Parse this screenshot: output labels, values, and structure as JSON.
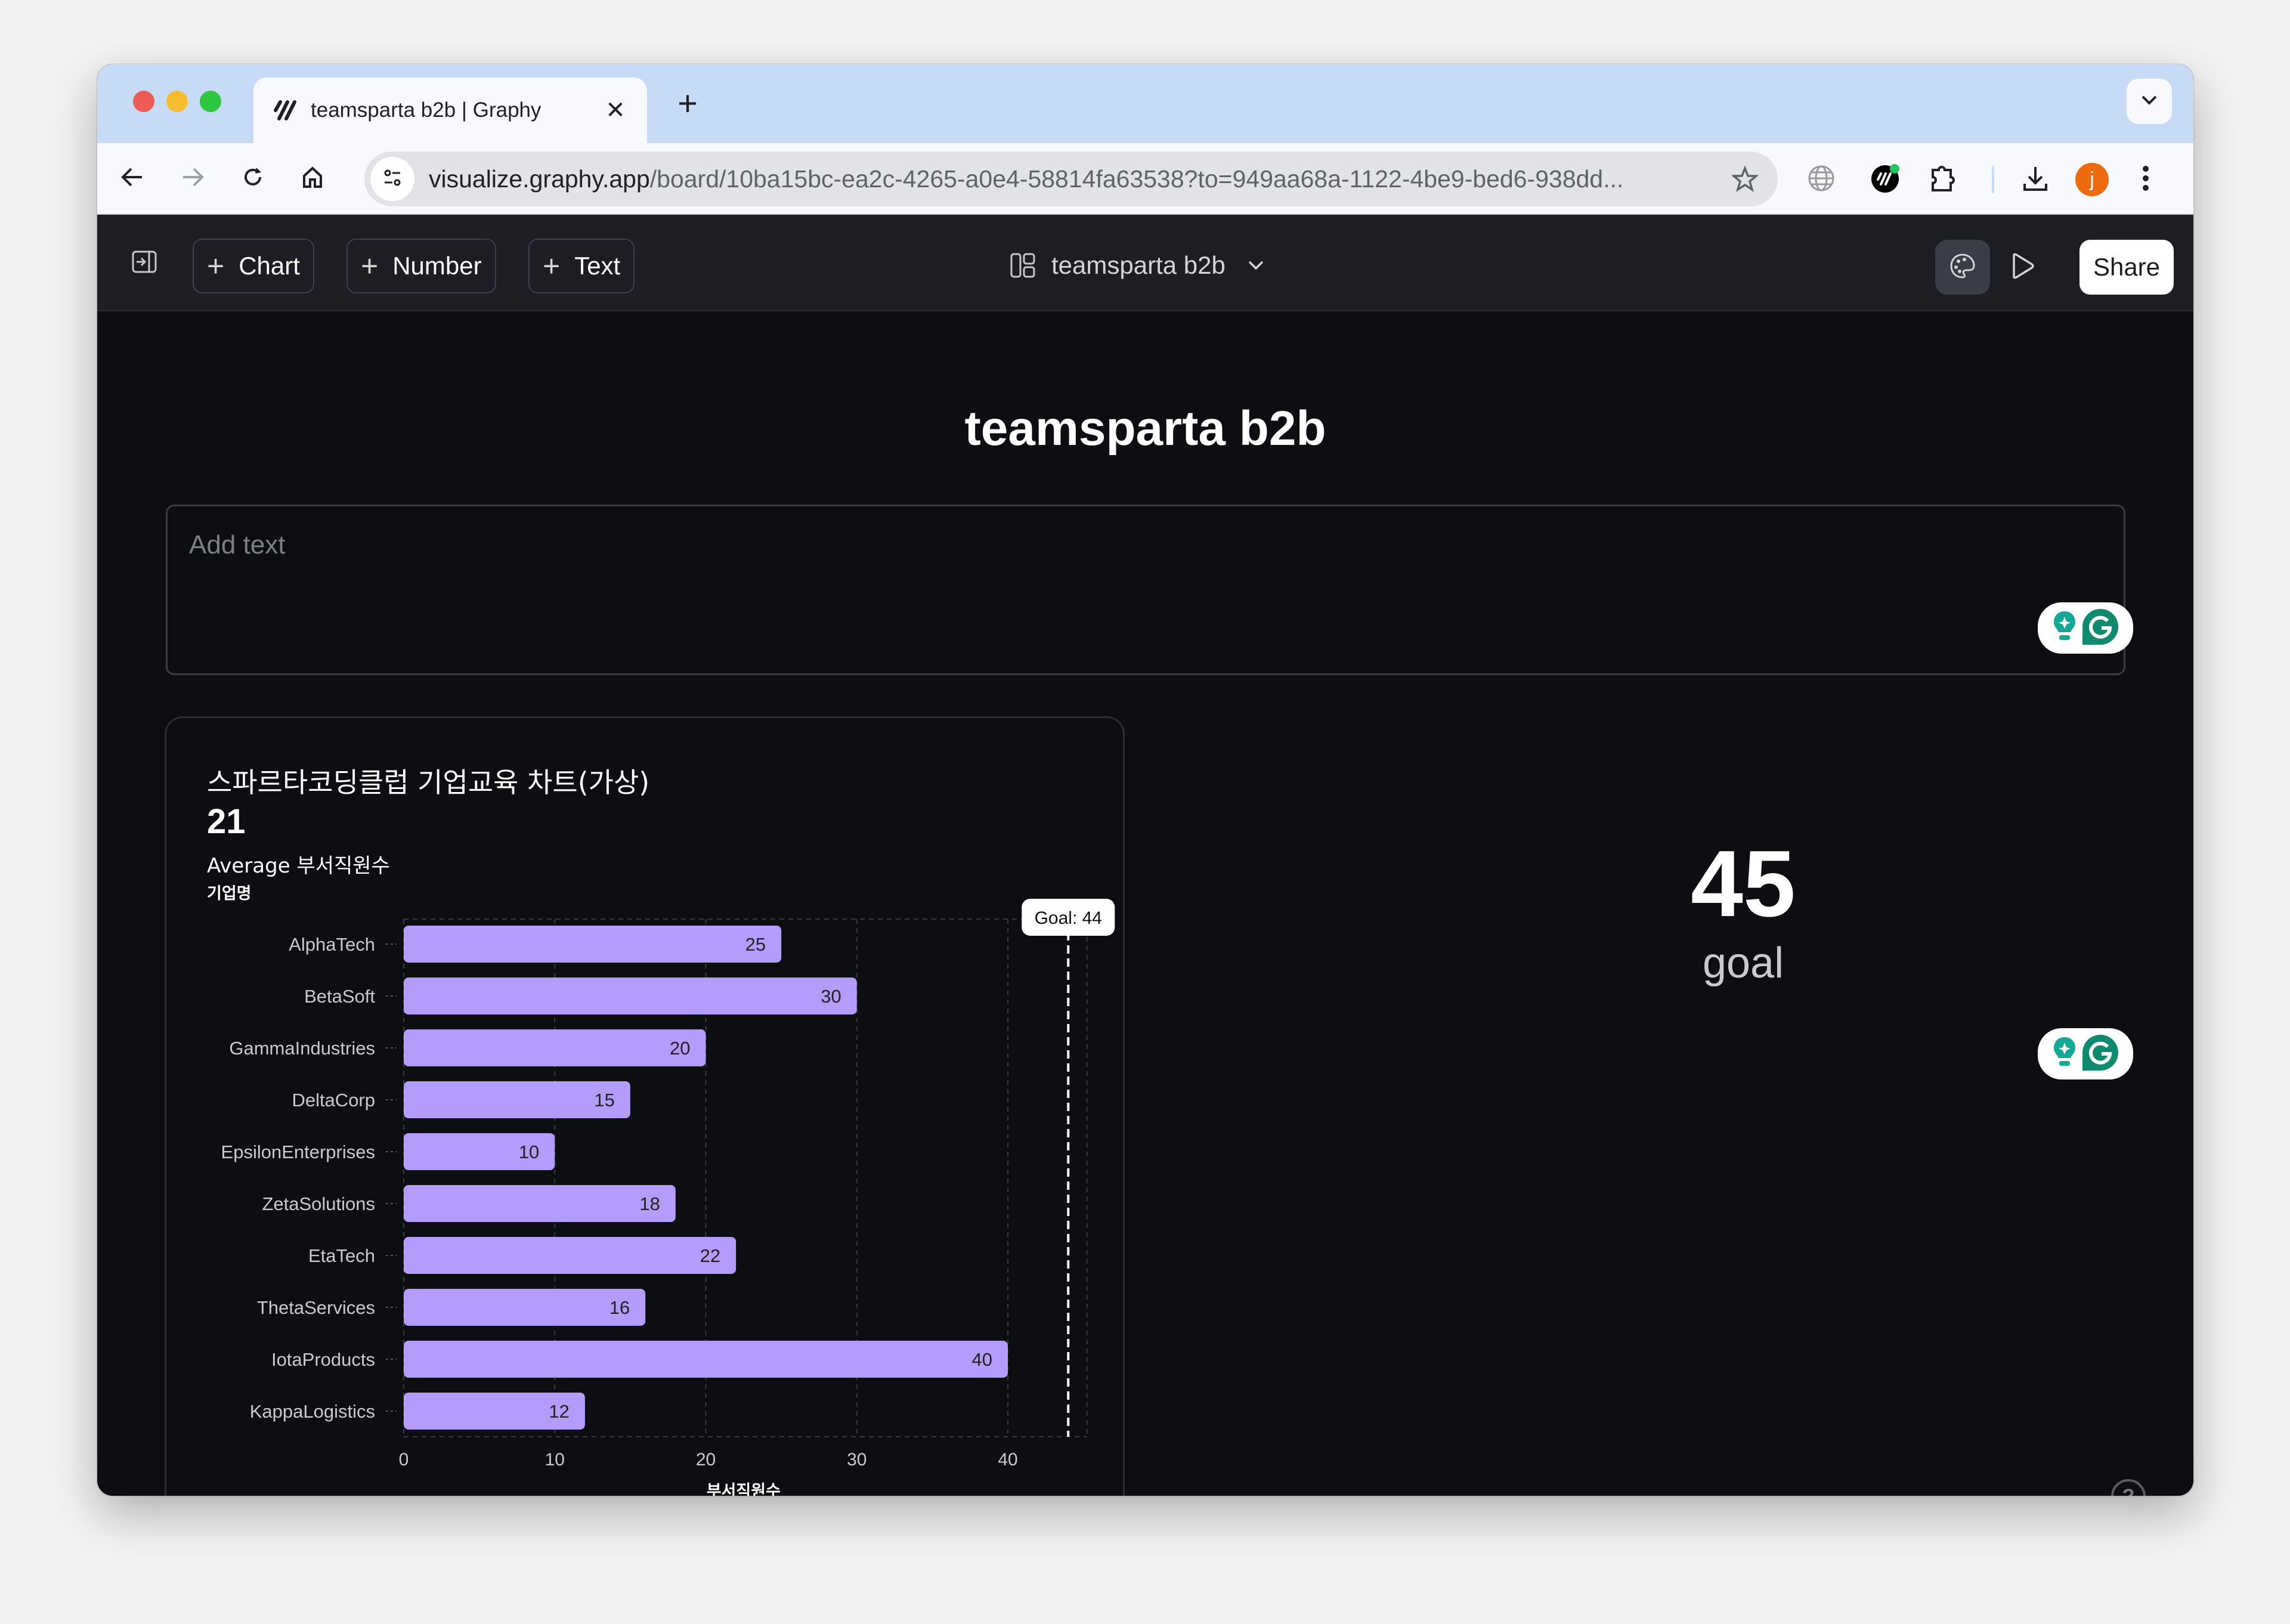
{
  "browser": {
    "tab": {
      "title": "teamsparta b2b | Graphy",
      "icon": "graphy-logo-icon"
    },
    "new_tab_label": "+",
    "url_host": "visualize.graphy.app",
    "url_path": "/board/10ba15bc-ea2c-4265-a0e4-58814fa63538?to=949aa68a-1122-4be9-bed6-938dd...",
    "profile_initial": "j",
    "colors": {
      "tabstrip": "#c8dbf6",
      "avatar": "#ee6a0e"
    }
  },
  "toolbar": {
    "add_chart": "Chart",
    "add_number": "Number",
    "add_text": "Text",
    "board_name": "teamsparta b2b",
    "share": "Share"
  },
  "board": {
    "title": "teamsparta b2b",
    "textbox_placeholder": "Add text"
  },
  "chart_widget": {
    "title": "스파르타코딩클럽 기업교육 차트(가상)",
    "metric_value": "21",
    "metric_label": "Average 부서직원수"
  },
  "number_widget": {
    "value": "45",
    "label": "goal"
  },
  "chart_data": {
    "type": "bar",
    "orientation": "horizontal",
    "title": "스파르타코딩클럽 기업교육 차트(가상)",
    "ylabel": "기업명",
    "xlabel": "부서직원수",
    "categories": [
      "AlphaTech",
      "BetaSoft",
      "GammaIndustries",
      "DeltaCorp",
      "EpsilonEnterprises",
      "ZetaSolutions",
      "EtaTech",
      "ThetaServices",
      "IotaProducts",
      "KappaLogistics"
    ],
    "values": [
      25,
      30,
      20,
      15,
      10,
      18,
      22,
      16,
      40,
      12
    ],
    "xlim": [
      0,
      45
    ],
    "xticks": [
      0,
      10,
      20,
      30,
      40
    ],
    "grid": true,
    "goal": {
      "value": 44,
      "label": "Goal: 44"
    },
    "bar_color": "#b39cfb",
    "data_labels": true
  }
}
